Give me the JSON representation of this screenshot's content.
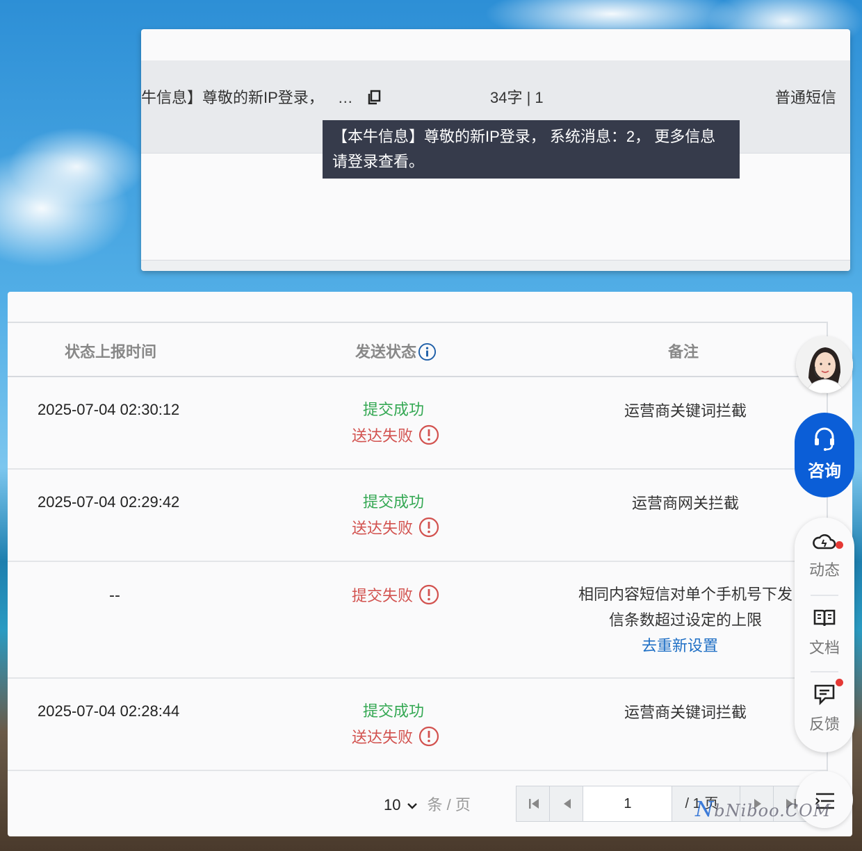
{
  "message_popup": {
    "content_truncated": "牛信息】尊敬的新IP登录，",
    "ellipsis": "…",
    "char_count": "34字 | 1",
    "type": "普通短信",
    "tooltip": "【本牛信息】尊敬的新IP登录， 系统消息：2， 更多信息请登录查看。"
  },
  "table": {
    "headers": {
      "report_time": "状态上报时间",
      "send_status": "发送状态",
      "remark": "备注"
    },
    "rows": [
      {
        "time": "2025-07-04 02:30:12",
        "submit": "提交成功",
        "deliver": "送达失败",
        "remark": "运营商关键词拦截"
      },
      {
        "time": "2025-07-04 02:29:42",
        "submit": "提交成功",
        "deliver": "送达失败",
        "remark": "运营商网关拦截"
      },
      {
        "time": "--",
        "submit": "",
        "deliver": "提交失败",
        "remark_line1": "相同内容短信对单个手机号下发",
        "remark_line2": "信条数超过设定的上限",
        "remark_link": "去重新设置"
      },
      {
        "time": "2025-07-04 02:28:44",
        "submit": "提交成功",
        "deliver": "送达失败",
        "remark": "运营商关键词拦截"
      }
    ]
  },
  "pagination": {
    "page_size": "10",
    "page_size_unit": "条 / 页",
    "current_page": "1",
    "total_pages": "/ 1 页"
  },
  "sidebar": {
    "consult": "咨询",
    "news": "动态",
    "docs": "文档",
    "feedback": "反馈"
  },
  "watermark": {
    "brand_n": "N",
    "brand_rest": "bNiboo.COM"
  },
  "colors": {
    "success": "#34a853",
    "fail": "#d2524f",
    "link": "#1f6fc5",
    "accent": "#0b5ed7",
    "tooltip_bg": "#363b4b"
  }
}
